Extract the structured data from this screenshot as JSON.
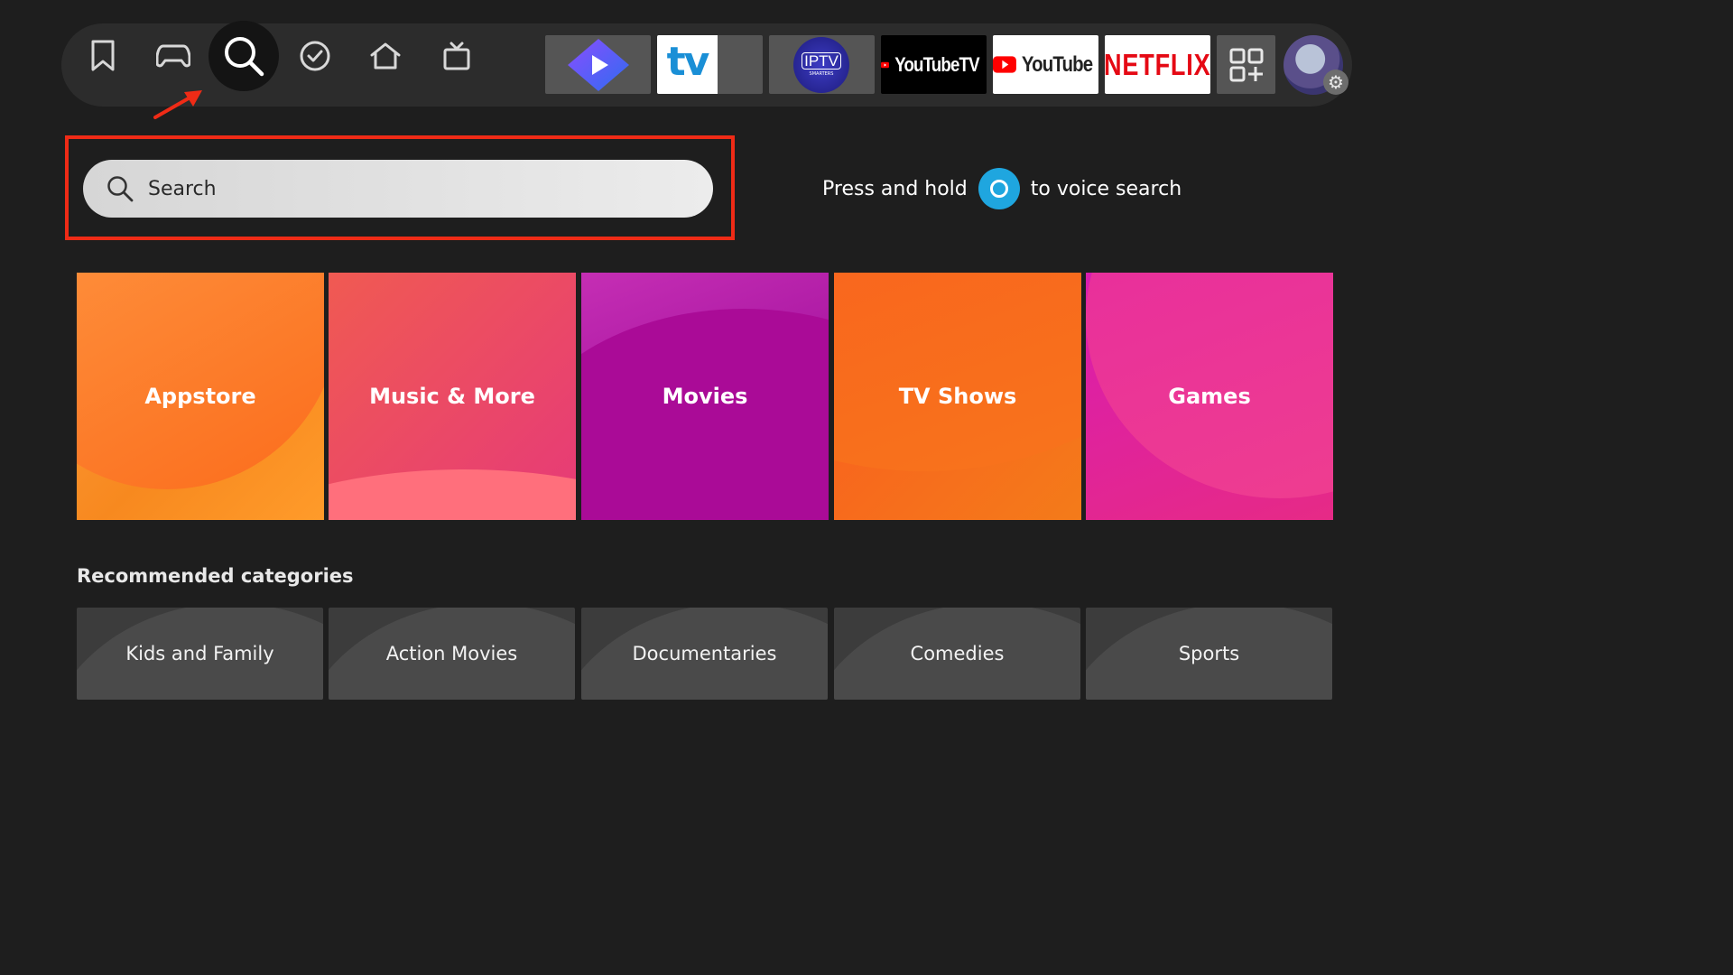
{
  "nav": {
    "icons": [
      {
        "name": "bookmark-icon",
        "active": false
      },
      {
        "name": "gamepad-icon",
        "active": false
      },
      {
        "name": "search-icon",
        "active": true
      },
      {
        "name": "check-circle-icon",
        "active": false
      },
      {
        "name": "home-icon",
        "active": false
      },
      {
        "name": "live-tv-icon",
        "active": false
      }
    ],
    "apps": [
      {
        "name": "play-app",
        "label": ""
      },
      {
        "name": "tv-app",
        "label": "tv"
      },
      {
        "name": "iptv-smarters-app",
        "label": "IPTV",
        "sublabel": "SMARTERS"
      },
      {
        "name": "youtube-tv-app",
        "label": "YouTubeTV"
      },
      {
        "name": "youtube-app",
        "label": "YouTube"
      },
      {
        "name": "netflix-app",
        "label": "NETFLIX"
      },
      {
        "name": "all-apps",
        "icon": "apps-grid-icon"
      }
    ],
    "profile": {
      "icon": "gear-icon"
    }
  },
  "search": {
    "placeholder": "Search",
    "voice_prefix": "Press and hold",
    "voice_suffix": "to voice search"
  },
  "categories": [
    {
      "label": "Appstore",
      "color": "#f7891f"
    },
    {
      "label": "Music & More",
      "color": "#ea4d6c"
    },
    {
      "label": "Movies",
      "color": "#b012a3"
    },
    {
      "label": "TV Shows",
      "color": "#f7731b"
    },
    {
      "label": "Games",
      "color": "#e3258c"
    }
  ],
  "recommended": {
    "title": "Recommended categories",
    "items": [
      "Kids and Family",
      "Action Movies",
      "Documentaries",
      "Comedies",
      "Sports"
    ]
  },
  "colors": {
    "highlight": "#ef2b16",
    "background": "#1e1e1e",
    "alexa": "#1fa6df"
  }
}
